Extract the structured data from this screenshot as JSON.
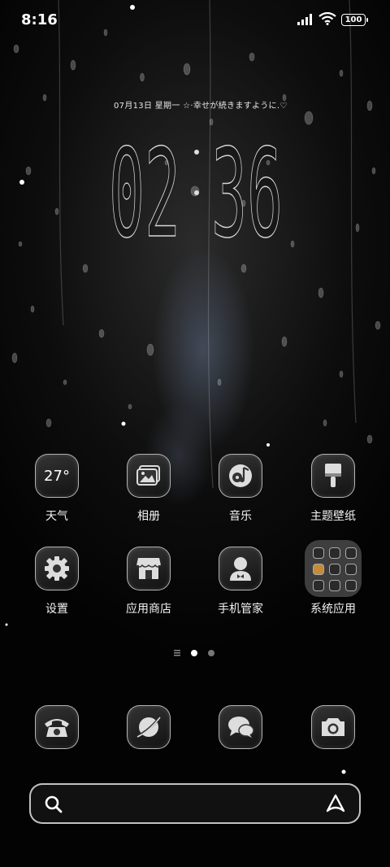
{
  "status_bar": {
    "time": "8:16",
    "battery": "100"
  },
  "lockclock": {
    "info_line": "07月13日  星期一 ☆·幸せが続きますように.♡",
    "hours": "02",
    "minutes": "36"
  },
  "apps": [
    {
      "label": "天气",
      "icon": "weather-icon",
      "value": "27°"
    },
    {
      "label": "相册",
      "icon": "gallery-icon"
    },
    {
      "label": "音乐",
      "icon": "music-icon"
    },
    {
      "label": "主题壁纸",
      "icon": "theme-brush-icon"
    },
    {
      "label": "设置",
      "icon": "gear-icon"
    },
    {
      "label": "应用商店",
      "icon": "store-icon"
    },
    {
      "label": "手机管家",
      "icon": "security-manager-icon"
    },
    {
      "label": "系统应用",
      "icon": "folder-icon"
    }
  ],
  "page_indicator": {
    "current": 2,
    "total": 2
  },
  "dock": [
    {
      "icon": "phone-icon"
    },
    {
      "icon": "browser-icon"
    },
    {
      "icon": "messages-icon"
    },
    {
      "icon": "camera-icon"
    }
  ],
  "search_bar": {
    "icons": [
      "search-icon",
      "assistant-icon"
    ]
  },
  "colors": {
    "frame": "#e0e0e0",
    "background": "#050505"
  }
}
